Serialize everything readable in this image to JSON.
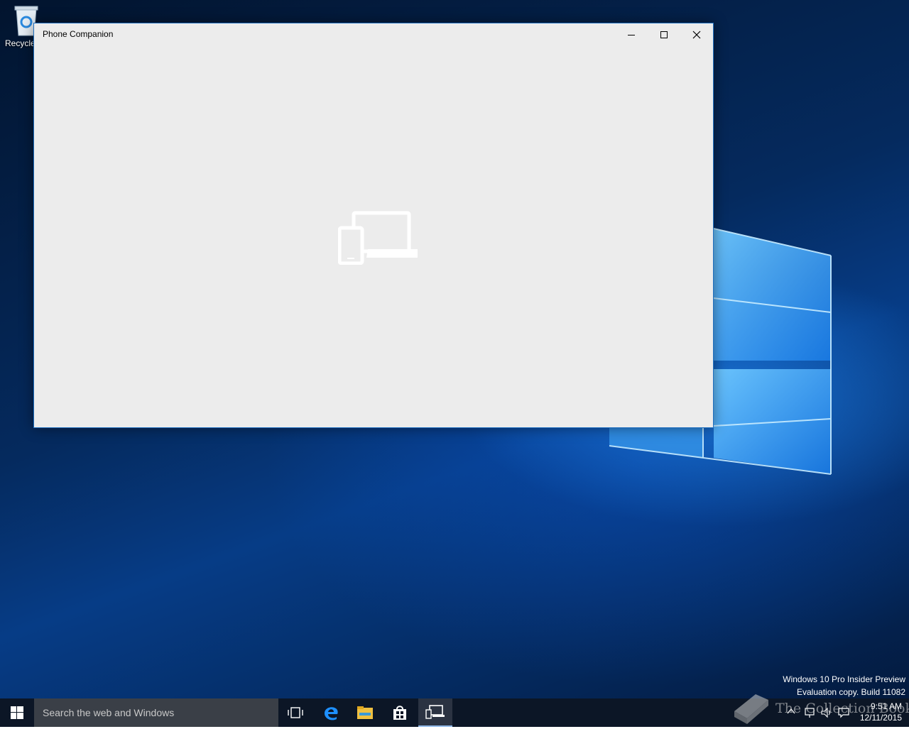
{
  "desktop": {
    "recycle_bin_label": "Recycle Bin"
  },
  "window": {
    "title": "Phone Companion",
    "minimize_icon": "minimize-icon",
    "maximize_icon": "maximize-icon",
    "close_icon": "close-icon",
    "splash_icon": "phone-laptop-icon"
  },
  "watermark": {
    "line1": "Windows 10 Pro Insider Preview",
    "line2": "Evaluation copy. Build 11082"
  },
  "taskbar": {
    "search_placeholder": "Search the web and Windows",
    "apps": [
      "task-view-icon",
      "edge-icon",
      "file-explorer-icon",
      "store-icon",
      "phone-companion-icon"
    ]
  },
  "tray": {
    "time": "9:51 AM",
    "date": "12/11/2015"
  },
  "overlay": {
    "site_text": "The Collection Book"
  },
  "colors": {
    "window_bg": "#ececec",
    "window_border": "#1f6fbf",
    "taskbar_bg": "#0c1626",
    "search_bg": "#3a3f47"
  }
}
